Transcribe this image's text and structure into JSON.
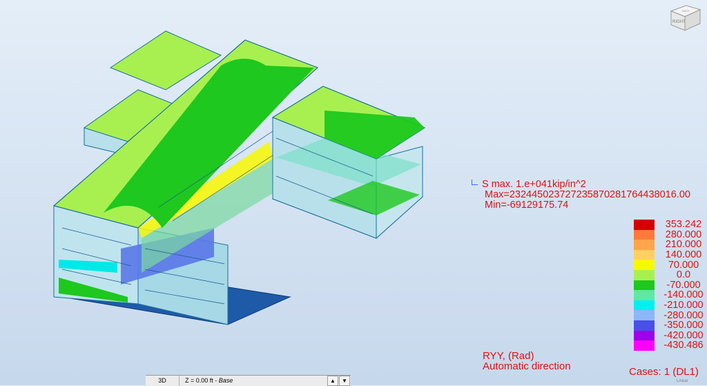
{
  "viewcube": {
    "face_label": "RIGHT",
    "top_label": "BACK"
  },
  "stress_info": {
    "title": "S max. 1.e+041kip/in^2",
    "max_line": "Max=2324450237272358702817644380​16.00",
    "min_line": "Min=-69129175.74"
  },
  "legend": [
    {
      "label": "353.242",
      "color": "#d40000"
    },
    {
      "label": "280.000",
      "color": "#ff7a3a"
    },
    {
      "label": "210.000",
      "color": "#ffa54d"
    },
    {
      "label": "140.000",
      "color": "#ffd060"
    },
    {
      "label": "70.000",
      "color": "#f8f800"
    },
    {
      "label": "0.0",
      "color": "#a8f050"
    },
    {
      "label": "-70.000",
      "color": "#1ec81e"
    },
    {
      "label": "-140.000",
      "color": "#60e8a0"
    },
    {
      "label": "-210.000",
      "color": "#00f0f0"
    },
    {
      "label": "-280.000",
      "color": "#8ab8f8"
    },
    {
      "label": "-350.000",
      "color": "#4850e8"
    },
    {
      "label": "-420.000",
      "color": "#a000e8"
    },
    {
      "label": "-430.486",
      "color": "#ff00ff"
    }
  ],
  "result": {
    "component": "RYY, (Rad)",
    "direction": "Automatic direction"
  },
  "cases": {
    "label": "Cases: 1 (DL1)",
    "sub": "Linear"
  },
  "statusbar": {
    "view": "3D",
    "level_prefix": "Z = 0.00 ft - ",
    "level_name": "Base",
    "up_arrow": "▲",
    "down_arrow": "▼"
  },
  "colors": {
    "light_green": "#a8f050",
    "green": "#1ec81e",
    "yellow": "#f8f800",
    "frame_blue": "#1a5890",
    "text_red": "#e01010"
  }
}
